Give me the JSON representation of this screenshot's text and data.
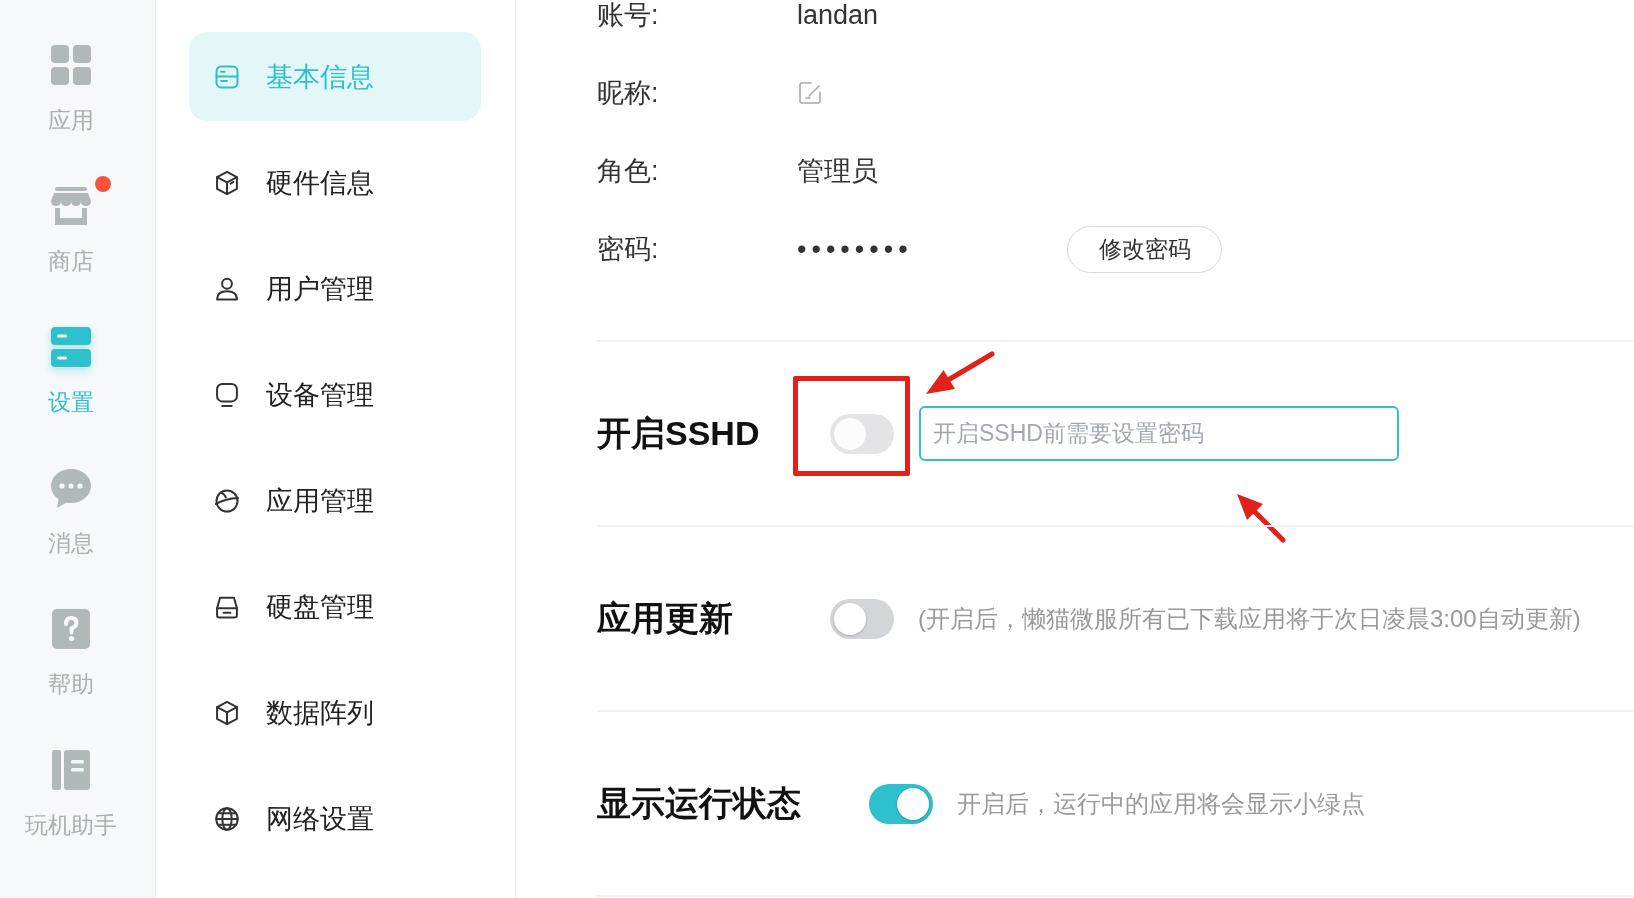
{
  "nav": [
    {
      "label": "应用",
      "selected": false,
      "badge": false
    },
    {
      "label": "商店",
      "selected": false,
      "badge": true
    },
    {
      "label": "设置",
      "selected": true,
      "badge": false
    },
    {
      "label": "消息",
      "selected": false,
      "badge": false
    },
    {
      "label": "帮助",
      "selected": false,
      "badge": false
    },
    {
      "label": "玩机助手",
      "selected": false,
      "badge": false
    }
  ],
  "sidebar": {
    "items": [
      {
        "label": "基本信息",
        "selected": true
      },
      {
        "label": "硬件信息",
        "selected": false
      },
      {
        "label": "用户管理",
        "selected": false
      },
      {
        "label": "设备管理",
        "selected": false
      },
      {
        "label": "应用管理",
        "selected": false
      },
      {
        "label": "硬盘管理",
        "selected": false
      },
      {
        "label": "数据阵列",
        "selected": false
      },
      {
        "label": "网络设置",
        "selected": false
      }
    ]
  },
  "profile": {
    "fields": [
      {
        "kind": "text",
        "label": "账号:",
        "value": "landan"
      },
      {
        "kind": "edit",
        "label": "昵称:"
      },
      {
        "kind": "text",
        "label": "角色:",
        "value": "管理员"
      },
      {
        "kind": "password",
        "label": "密码:",
        "value": "••••••••",
        "action": "修改密码"
      }
    ]
  },
  "settings": [
    {
      "kind": "input",
      "title": "开启SSHD",
      "on": false,
      "disabled": true,
      "input": {
        "placeholder": "开启SSHD前需要设置密码"
      }
    },
    {
      "kind": "note",
      "title": "应用更新",
      "on": false,
      "disabled": false,
      "note": "(开启后，懒猫微服所有已下载应用将于次日凌晨3:00自动更新)"
    },
    {
      "kind": "note",
      "title": "显示运行状态",
      "on": true,
      "disabled": false,
      "note": "开启后，运行中的应用将会显示小绿点"
    }
  ]
}
